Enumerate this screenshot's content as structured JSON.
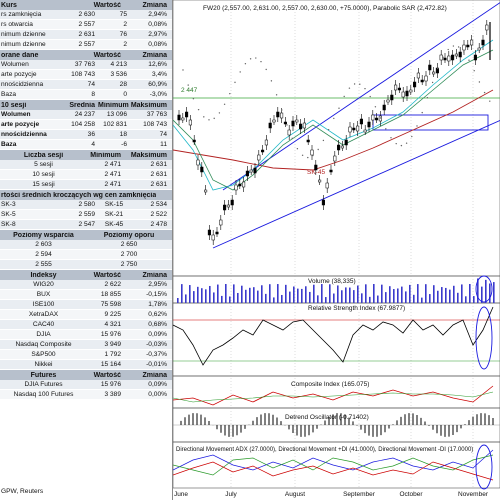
{
  "left": {
    "s1": {
      "head": [
        "Kurs",
        "Wartość",
        "Zmiana"
      ],
      "rows": [
        [
          "rs zamknięcia",
          "2 630",
          "75",
          "2,94%"
        ],
        [
          "rs otwarcia",
          "2 557",
          "2",
          "0,08%"
        ],
        [
          "nimum dzienne",
          "2 631",
          "76",
          "2,97%"
        ],
        [
          "nimum dzienne",
          "2 557",
          "2",
          "0,08%"
        ]
      ]
    },
    "s2": {
      "head": [
        "orane dane",
        "Wartość",
        "Zmiana"
      ],
      "rows": [
        [
          "Wolumen",
          "37 763",
          "4 213",
          "12,6%"
        ],
        [
          "arte pozycje",
          "108 743",
          "3 536",
          "3,4%"
        ],
        [
          "nnościdzienna",
          "74",
          "28",
          "60,9%"
        ],
        [
          "Baza",
          "8",
          "0",
          "-3,0%"
        ]
      ]
    },
    "s3": {
      "head": [
        "10 sesji",
        "Średnia",
        "Minimum",
        "Maksimum"
      ],
      "rows": [
        [
          "Wolumen",
          "24 237",
          "13 096",
          "37 763"
        ],
        [
          "arte pozycje",
          "104 258",
          "102 831",
          "108 743"
        ],
        [
          "nnościdzienna",
          "36",
          "18",
          "74"
        ],
        [
          "Baza",
          "4",
          "-6",
          "11"
        ]
      ]
    },
    "s4": {
      "head": [
        "Liczba sesji",
        "Minimum",
        "Maksimum"
      ],
      "rows": [
        [
          "5 sesji",
          "2 471",
          "2 631"
        ],
        [
          "10 sesji",
          "2 471",
          "2 631"
        ],
        [
          "15 sesji",
          "2 471",
          "2 631"
        ]
      ]
    },
    "s5": {
      "head": "rtości średnich kroczących wg cen zamknięcia",
      "rows": [
        [
          "SK-3",
          "2 580",
          "SK-15",
          "2 534"
        ],
        [
          "SK-5",
          "2 559",
          "SK-21",
          "2 522"
        ],
        [
          "SK-8",
          "2 547",
          "SK-45",
          "2 478"
        ]
      ]
    },
    "s6": {
      "head": [
        "Poziomy wsparcia",
        "Poziomy oporu"
      ],
      "rows": [
        [
          "2 603",
          "2 650"
        ],
        [
          "2 594",
          "2 700"
        ],
        [
          "2 555",
          "2 750"
        ]
      ]
    },
    "s7": {
      "head": [
        "Indeksy",
        "Wartość",
        "Zmiana"
      ],
      "rows": [
        [
          "WIG20",
          "2 622",
          "2,95%"
        ],
        [
          "BUX",
          "18 855",
          "-0,15%"
        ],
        [
          "ISE100",
          "75 598",
          "1,78%"
        ],
        [
          "XetraDAX",
          "9 225",
          "0,62%"
        ],
        [
          "CAC40",
          "4 321",
          "0,68%"
        ],
        [
          "DJIA",
          "15 976",
          "0,09%"
        ],
        [
          "Nasdaq Composite",
          "3 949",
          "-0,03%"
        ],
        [
          "S&P500",
          "1 792",
          "-0,37%"
        ],
        [
          "Nikkei",
          "15 164",
          "-0,01%"
        ]
      ]
    },
    "s8": {
      "head": [
        "Futures",
        "Wartość",
        "Zmiana"
      ],
      "rows": [
        [
          "DJIA Futures",
          "15 976",
          "0,09%"
        ],
        [
          "Nasdaq 100 Futures",
          "3 389",
          "0,00%"
        ]
      ]
    },
    "footer": "GPW, Reuters"
  },
  "chart": {
    "main_title": "FW20 (2,557.00, 2,631.00, 2,557.00, 2,630.00, +75.0000), Parabolic SAR (2,472.82)",
    "level_label": "2 447",
    "sk45_label": "SK-45",
    "volume_title": "Volume (38,335)",
    "rsi_title": "Relative Strength Index (67.9877)",
    "composite_title": "Composite Index (165.075)",
    "dosc_title": "Detrend Oscillator (-0.71402)",
    "dmi_title": "Directional Movement ADX (27.0000), Directional Movement +DI (41.0000), Directional Movement -DI (17.0000)",
    "months": [
      "June",
      "July",
      "August",
      "September",
      "October",
      "November"
    ]
  },
  "colors": {
    "section_head": "#b7c0cc",
    "row_bg": "#e9edf2",
    "candle": "#000000",
    "channel": "#1a1adf",
    "sk_red": "#b22222",
    "sk_green": "#2e8b57",
    "sk_cyan": "#21b8c8",
    "level_green": "#3aa83a"
  }
}
